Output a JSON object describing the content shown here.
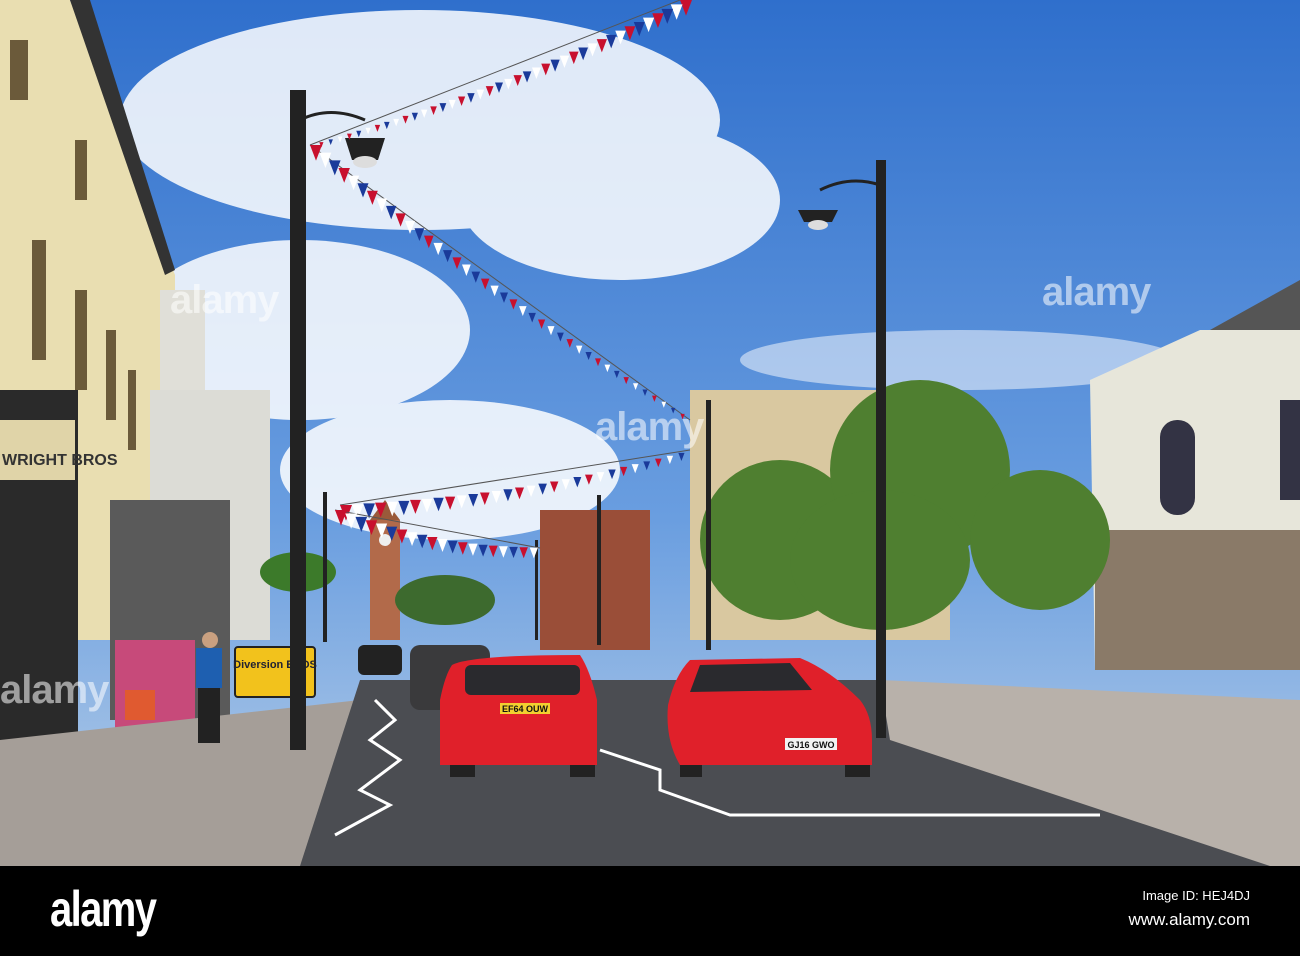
{
  "photo": {
    "shop_sign": "WRIGHT BROS",
    "road_sign": "Diversion ENDS",
    "plate_front_car": "EF64 OUW",
    "plate_audi": "GJ16 GWO",
    "colors": {
      "sky": "#3f7fd2",
      "car": "#e0202a",
      "road": "#4b4d52",
      "building": "#e8dcae"
    }
  },
  "watermarks": [
    "alamy",
    "alamy",
    "alamy",
    "alamy"
  ],
  "footer": {
    "logo": "alamy",
    "image_id": "Image ID: HEJ4DJ",
    "url": "www.alamy.com"
  }
}
